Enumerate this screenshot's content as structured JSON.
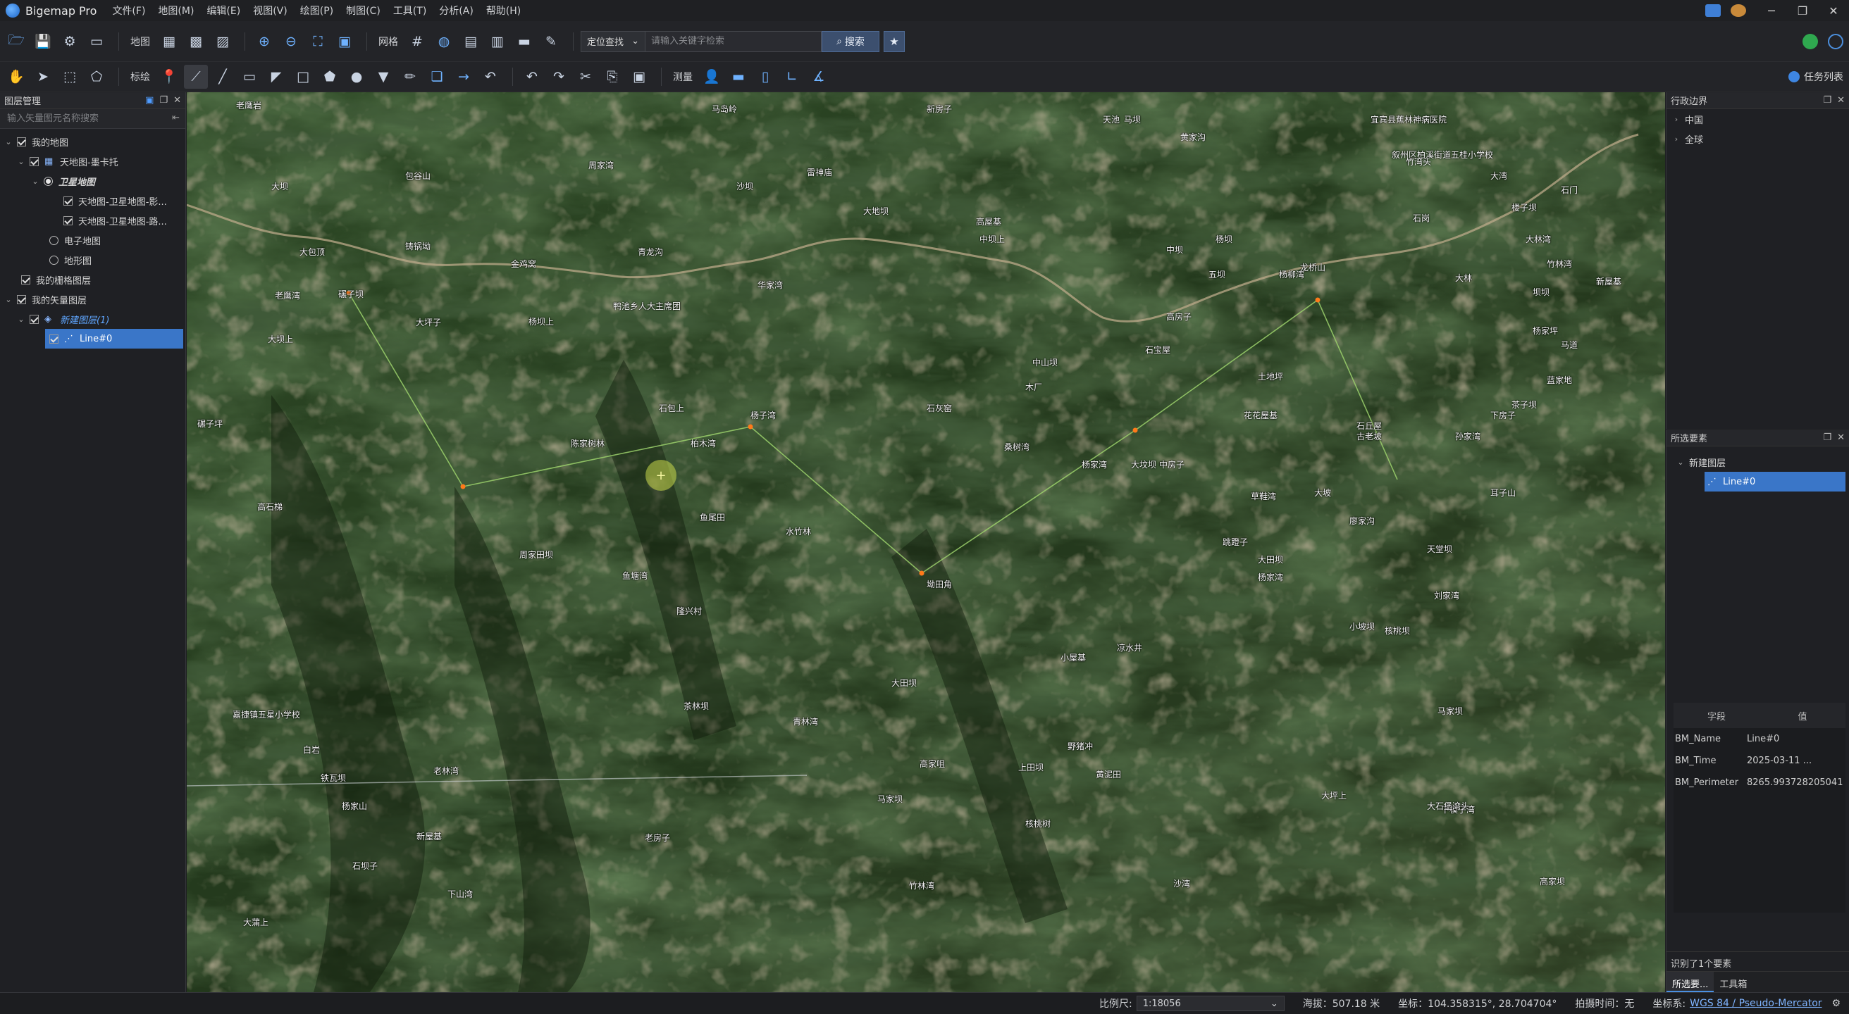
{
  "app": {
    "title": "Bigemap Pro"
  },
  "menu": [
    "文件(F)",
    "地图(M)",
    "编辑(E)",
    "视图(V)",
    "绘图(P)",
    "制图(C)",
    "工具(T)",
    "分析(A)",
    "帮助(H)"
  ],
  "toolbar1": {
    "map_label": "地图",
    "grid_label": "网格",
    "locate_option": "定位查找",
    "search_placeholder": "请输入关键字检索",
    "search_label": "搜索"
  },
  "toolbar2": {
    "annotate_label": "标绘",
    "measure_label": "测量",
    "task_list_label": "任务列表"
  },
  "left_panel": {
    "title": "图层管理",
    "search_placeholder": "输入矢量图元名称搜索",
    "tree": [
      {
        "label": "我的地图"
      },
      {
        "label": "天地图-墨卡托"
      },
      {
        "label": "卫星地图"
      },
      {
        "label": "天地图-卫星地图-影..."
      },
      {
        "label": "天地图-卫星地图-路..."
      },
      {
        "label": "电子地图"
      },
      {
        "label": "地形图"
      },
      {
        "label": "我的栅格图层"
      },
      {
        "label": "我的矢量图层"
      },
      {
        "label": "新建图层(1)"
      },
      {
        "label": "Line#0"
      }
    ]
  },
  "right_top": {
    "title": "行政边界",
    "items": [
      "中国",
      "全球"
    ]
  },
  "right_bottom": {
    "title": "所选要素",
    "layer": "新建图层",
    "feature": "Line#0",
    "table_headers": [
      "字段",
      "值"
    ],
    "rows": [
      {
        "key": "BM_Name",
        "value": "Line#0"
      },
      {
        "key": "BM_Time",
        "value": "2025-03-11 ..."
      },
      {
        "key": "BM_Perimeter",
        "value": "8265.993728205041"
      }
    ],
    "footer": "识别了1个要素",
    "tabs": [
      "所选要...",
      "工具箱"
    ]
  },
  "map_labels": [
    "马岛岭",
    "新房子",
    "包谷山",
    "大坝",
    "周家湾",
    "雷神庙",
    "大地坝",
    "马坝",
    "高屋基",
    "黄家沟",
    "沙坝",
    "老鹰岩",
    "天池",
    "宜宾县蕉林神病医院",
    "叙州区柏溪街道五桂小学校",
    "竹湾头",
    "楼子坝",
    "大林湾",
    "石门",
    "大湾",
    "竹林湾",
    "坝坝",
    "高房子",
    "杨坝",
    "石岗",
    "杨家坪",
    "马道",
    "蓝家地",
    "中坝上",
    "中坝",
    "五坝",
    "杨柳湾",
    "龙桥山",
    "大林",
    "新屋基",
    "金鸡窝",
    "青龙沟",
    "铸锅坳",
    "鸭池乡人大主席团",
    "华家湾",
    "大包顶",
    "老鹰湾",
    "碾子坝",
    "大坪子",
    "杨坝上",
    "大坝上",
    "石宝屋",
    "陈家树林",
    "柏木湾",
    "杨子湾",
    "石包上",
    "石灰窑",
    "木厂",
    "中山坝",
    "花花屋基",
    "土地坪",
    "大坟坝",
    "石丘屋",
    "孙家湾",
    "下房子",
    "茶子坝",
    "桑树湾",
    "中房子",
    "杨家湾",
    "草鞋湾",
    "大坡",
    "古老坡",
    "耳子山",
    "天堂坝",
    "碾子坪",
    "高石梯",
    "周家田坝",
    "鱼塘湾",
    "隆兴村",
    "鱼尾田",
    "水竹林",
    "坳田角",
    "小屋基",
    "凉水井",
    "跳蹬子",
    "杨家湾",
    "大田坝",
    "刘家湾",
    "核桃坝",
    "廖家沟",
    "小坡坝",
    "茶林坝",
    "青林湾",
    "大田坝",
    "马家坝",
    "高家咀",
    "上田坝",
    "黄泥田",
    "野猪冲",
    "老林湾",
    "白岩",
    "嘉捷镇五星小学校",
    "铁瓦坝",
    "杨家山",
    "老房子",
    "核桃树",
    "新屋基",
    "大坪上",
    "下模子湾",
    "大石堡湾头",
    "马家坝",
    "石坝子",
    "下山湾",
    "高家坝",
    "沙湾",
    "竹林湾",
    "大蒲上"
  ],
  "status": {
    "scale_label": "比例尺:",
    "scale_value": "1:18056",
    "elevation": "海拔：507.18 米",
    "coord": "坐标：104.358315°, 28.704704°",
    "capture_time": "拍摄时间：无",
    "crs_label": "坐标系:",
    "crs_value": "WGS 84 / Pseudo-Mercator"
  }
}
